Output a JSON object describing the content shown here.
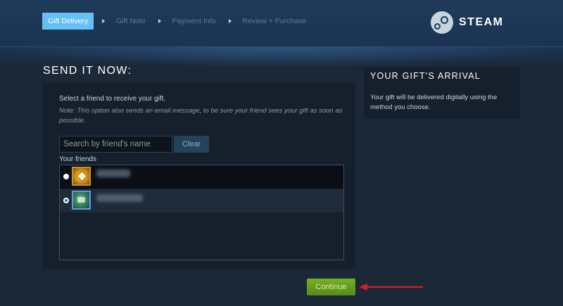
{
  "steps": [
    "Gift Delivery",
    "Gift Note",
    "Payment Info",
    "Review + Purchase"
  ],
  "logo": {
    "text": "STEAM"
  },
  "send": {
    "title": "SEND IT NOW:",
    "instruction": "Select a friend to receive your gift.",
    "note": "Note: This option also sends an email message, to be sure your friend sees your gift as soon as possible.",
    "search_placeholder": "Search by friend's name",
    "clear_label": "Clear",
    "friends_label": "Your friends"
  },
  "arrival": {
    "title": "YOUR GIFT'S ARRIVAL",
    "body": "Your gift will be delivered digitally using the method you choose."
  },
  "continue_label": "Continue",
  "colors": {
    "accent": "#66c0f4",
    "continue_green": "#75b022",
    "annotation_red": "#d0202a"
  }
}
